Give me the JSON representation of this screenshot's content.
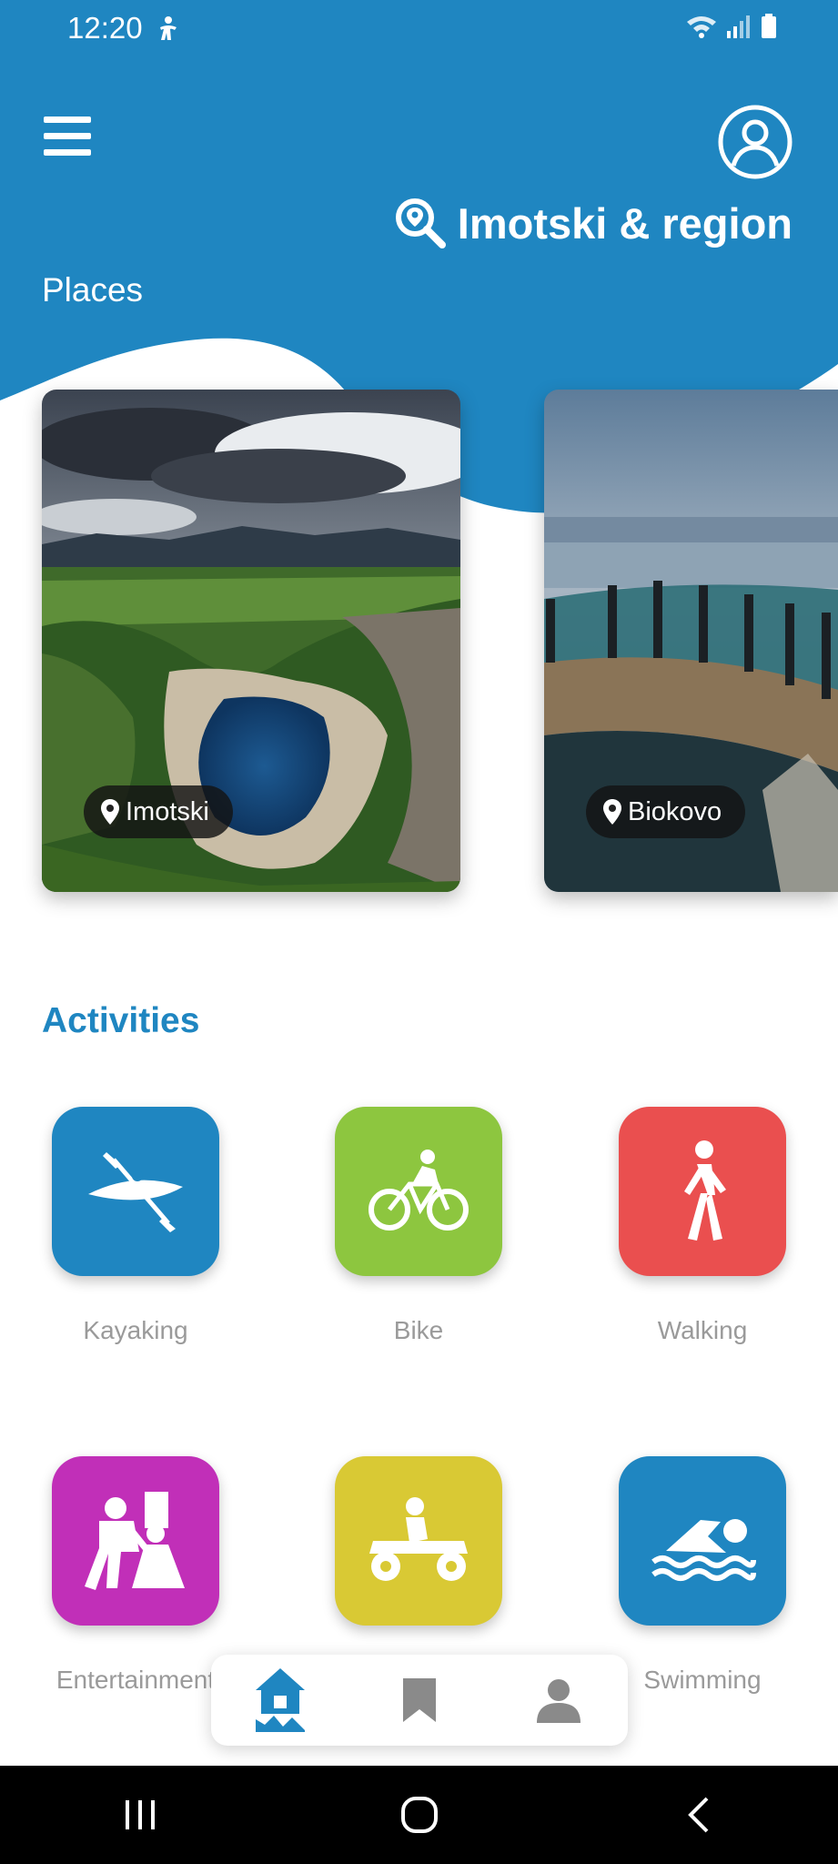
{
  "status_bar": {
    "time": "12:20"
  },
  "header": {
    "region_title": "Imotski & region",
    "places_label": "Places"
  },
  "places": [
    {
      "name": "Imotski"
    },
    {
      "name": "Biokovo"
    }
  ],
  "activities": {
    "title": "Activities",
    "items": [
      {
        "label": "Kayaking",
        "color": "#1f86c1",
        "icon": "kayak-icon"
      },
      {
        "label": "Bike",
        "color": "#8dc63f",
        "icon": "bike-icon"
      },
      {
        "label": "Walking",
        "color": "#ea4f4f",
        "icon": "walking-icon"
      },
      {
        "label": "Entertainment",
        "color": "#c12fb8",
        "icon": "dancing-icon"
      },
      {
        "label": "",
        "color": "#d9c934",
        "icon": "quad-bike-icon"
      },
      {
        "label": "Swimming",
        "color": "#1f86c1",
        "icon": "swimming-icon"
      }
    ]
  },
  "colors": {
    "brand": "#1f86c1",
    "background": "#ffffff"
  }
}
